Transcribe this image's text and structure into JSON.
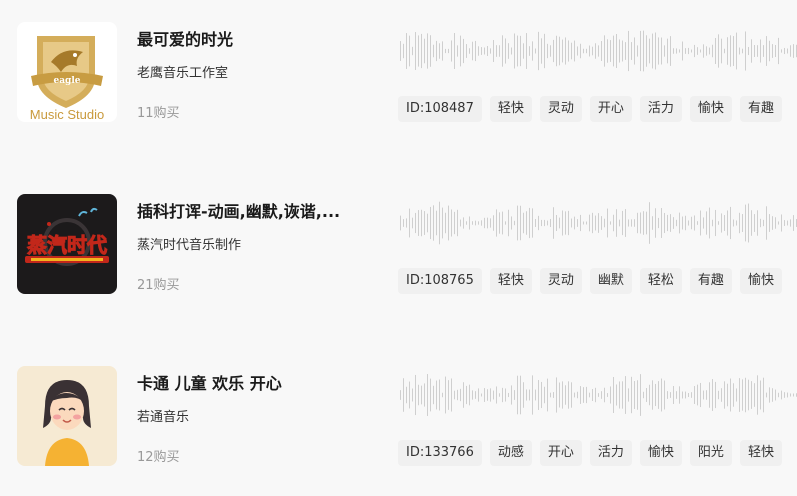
{
  "tracks": [
    {
      "title": "最可爱的时光",
      "author": "老鹰音乐工作室",
      "purchases": "11购买",
      "id_label": "ID:108487",
      "tags": [
        "轻快",
        "灵动",
        "开心",
        "活力",
        "愉快",
        "有趣"
      ],
      "cover": {
        "logo_word": "eagle",
        "logo_caption": "Music Studio"
      }
    },
    {
      "title": "插科打诨-动画,幽默,诙谐,...",
      "author": "蒸汽时代音乐制作",
      "purchases": "21购买",
      "id_label": "ID:108765",
      "tags": [
        "轻快",
        "灵动",
        "幽默",
        "轻松",
        "有趣",
        "愉快"
      ],
      "cover": {
        "logo_word": "蒸汽时代"
      }
    },
    {
      "title": "卡通 儿童 欢乐 开心",
      "author": "若通音乐",
      "purchases": "12购买",
      "id_label": "ID:133766",
      "tags": [
        "动感",
        "开心",
        "活力",
        "愉快",
        "阳光",
        "轻快"
      ],
      "cover": {}
    }
  ]
}
